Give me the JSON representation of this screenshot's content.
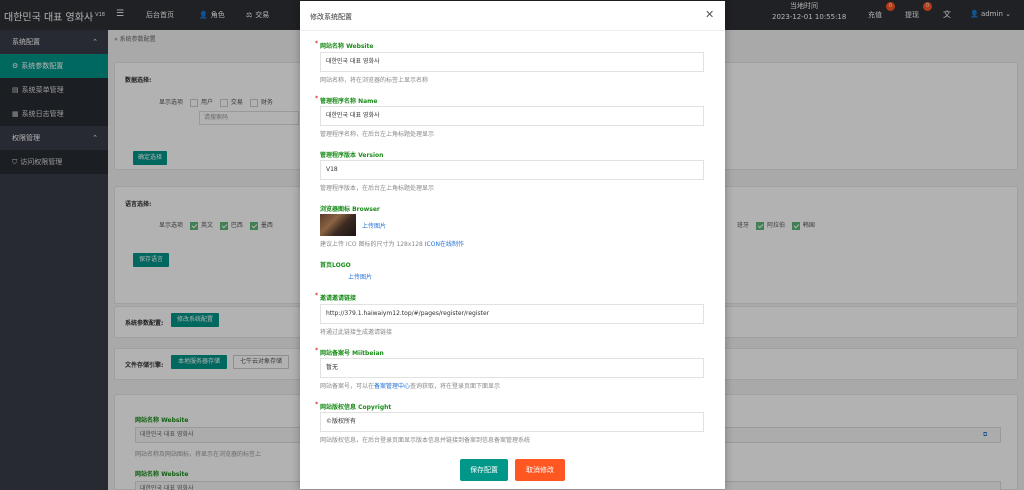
{
  "header": {
    "brand": "대한민국 대표 영화사",
    "version": "V18",
    "nav": [
      {
        "label": "后台首页"
      },
      {
        "label": "角色"
      },
      {
        "label": "交易"
      }
    ],
    "time_label": "当地时间",
    "time_value": "2023-12-01 10:55:18",
    "recharge": {
      "label": "充值",
      "count": "0"
    },
    "withdraw": {
      "label": "提现",
      "count": "0"
    },
    "user": "admin"
  },
  "sidebar": {
    "groups": [
      {
        "label": "系统配置",
        "items": [
          {
            "label": "系统参数配置",
            "active": true
          },
          {
            "label": "系统菜单管理"
          },
          {
            "label": "系统日志管理"
          }
        ]
      },
      {
        "label": "权限管理",
        "items": [
          {
            "label": "访问权限管理"
          }
        ]
      }
    ]
  },
  "main": {
    "breadcrumb": "系统参数配置",
    "data_section": {
      "title": "数据选择:",
      "display_label": "显示选项",
      "options": [
        "用户",
        "交易",
        "财务"
      ],
      "placeholder": "请搜索码",
      "confirm_button": "确定选择"
    },
    "lang_section": {
      "title": "语言选择:",
      "display_label": "显示选项",
      "options": [
        "英文",
        "巴西",
        "墨西"
      ],
      "right_options": [
        "班牙",
        "阿拉伯",
        "韩国"
      ],
      "save_button": "保存语言"
    },
    "param_section": {
      "title": "系统参数配置:",
      "button": "修改系统配置"
    },
    "storage_section": {
      "title": "文件存储引擎:",
      "buttons": [
        "本地服务器存储",
        "七牛云对象存储"
      ]
    },
    "preview": {
      "label": "网站名称 Website",
      "value": "대한민국 대표 영화사",
      "help": "网站名称及网站图标，将显示在浏览器的标签上",
      "label2": "网站名称 Website",
      "value2": "대한민국 대표 영화사"
    }
  },
  "modal": {
    "title": "修改系统配置",
    "fields": {
      "website": {
        "label": "网站名称 Website",
        "value": "대한민국 대표 영화사",
        "help": "网站名称，将在浏览器的标签上显示名称"
      },
      "name": {
        "label": "管理程序名称 Name",
        "value": "대한민국 대표 영화사",
        "help": "管理程序名称，在后台左上角标题处理显示"
      },
      "version": {
        "label": "管理程序版本 Version",
        "value": "V18",
        "help": "管理程序版本，在后台左上角标题处理显示"
      },
      "browser": {
        "label": "浏览器图标 Browser",
        "upload": "上传图片",
        "help": "建议上传 ICO 图标的尺寸为 128x128 ",
        "help_link": "ICON在线制作"
      },
      "logo": {
        "label": "首页LOGO",
        "upload": "上传图片"
      },
      "invite": {
        "label": "邀请邀请链接",
        "value": "http://379.1.haiwaiym12.top/#/pages/register/register",
        "help": "将通过此链接生成邀请链接"
      },
      "icp": {
        "label": "网站备案号 Miitbeian",
        "value": "暂无",
        "help_prefix": "网站备案号，可以在",
        "help_link": "备案管理中心",
        "help_suffix": "查询获取，将在登录页面下面显示"
      },
      "copyright": {
        "label": "网站版权信息 Copyright",
        "value": "©版权所有",
        "help": "网站版权信息，在后台登录页面显示版本信息并链接到备案到信息备案管理系统"
      }
    },
    "save_button": "保存配置",
    "cancel_button": "取消修改"
  }
}
